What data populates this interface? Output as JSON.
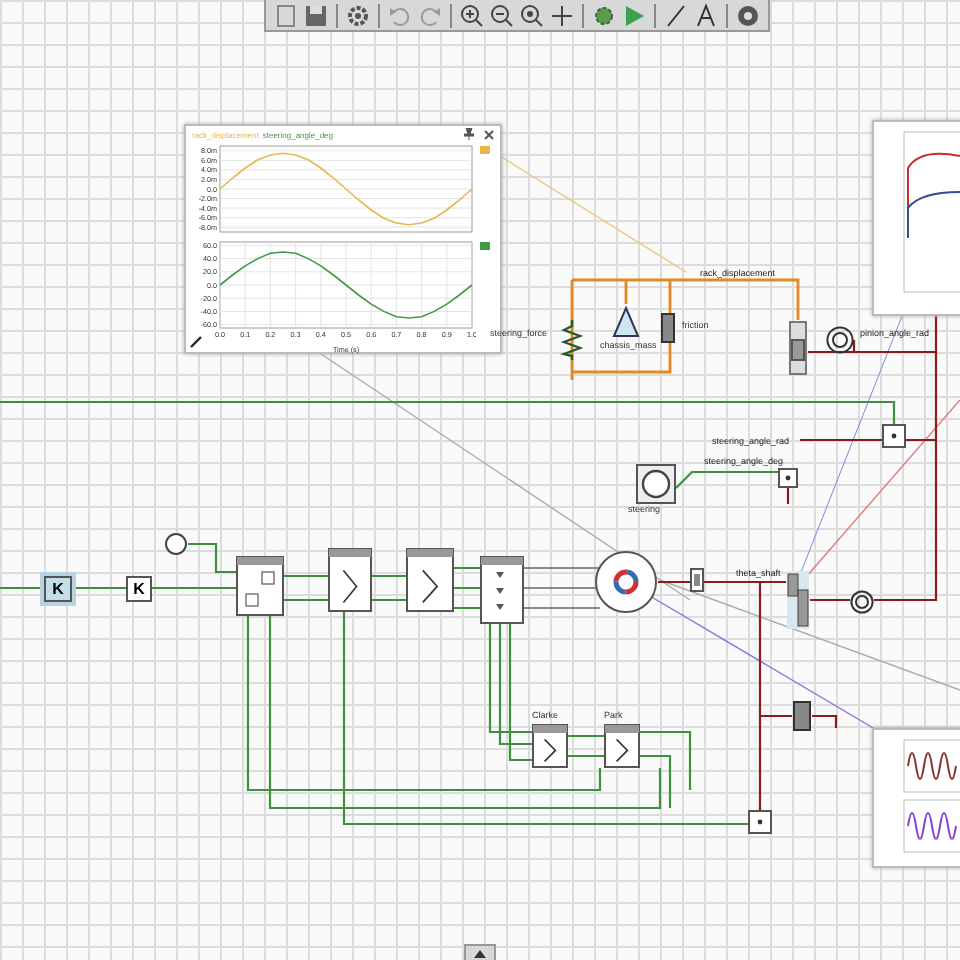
{
  "toolbar": {
    "buttons": [
      {
        "kind": "new"
      },
      {
        "kind": "save"
      },
      {
        "kind": "settings"
      },
      {
        "kind": "undo"
      },
      {
        "kind": "redo"
      },
      {
        "kind": "zoom-in"
      },
      {
        "kind": "zoom-out"
      },
      {
        "kind": "zoom-fit"
      },
      {
        "kind": "pan"
      },
      {
        "kind": "sim-settings"
      },
      {
        "kind": "run"
      },
      {
        "kind": "line"
      },
      {
        "kind": "text"
      },
      {
        "kind": "help"
      }
    ]
  },
  "plot_window": {
    "charts": [
      {
        "chart_data": {
          "type": "line",
          "grid": true,
          "x": [
            0,
            0.05,
            0.1,
            0.15,
            0.2,
            0.25,
            0.3,
            0.35,
            0.4,
            0.45,
            0.5,
            0.55,
            0.6,
            0.65,
            0.7,
            0.75,
            0.8,
            0.85,
            0.9,
            0.95,
            1
          ],
          "xlim": [
            0,
            1
          ],
          "ylim": [
            -9,
            9
          ],
          "yticks": [
            {
              "value": 8,
              "label": "8.0m"
            },
            {
              "value": 6,
              "label": "6.0m"
            },
            {
              "value": 4,
              "label": "4.0m"
            },
            {
              "value": 2,
              "label": "2.0m"
            },
            {
              "value": 0,
              "label": "0.0"
            },
            {
              "value": -2,
              "label": "-2.0m"
            },
            {
              "value": -4,
              "label": "-4.0m"
            },
            {
              "value": -6,
              "label": "-6.0m"
            },
            {
              "value": -8,
              "label": "-8.0m"
            }
          ],
          "series": [
            {
              "name": "rack_displacement",
              "color": "#e6b84c",
              "values": [
                0,
                2.3,
                4.4,
                6.1,
                7.1,
                7.5,
                7.1,
                6.1,
                4.4,
                2.3,
                0,
                -2.3,
                -4.4,
                -6.1,
                -7.1,
                -7.5,
                -7.1,
                -6.1,
                -4.4,
                -2.3,
                0
              ]
            }
          ]
        }
      },
      {
        "chart_data": {
          "type": "line",
          "grid": true,
          "xlabel": "Time (s)",
          "x": [
            0,
            0.05,
            0.1,
            0.15,
            0.2,
            0.25,
            0.3,
            0.35,
            0.4,
            0.45,
            0.5,
            0.55,
            0.6,
            0.65,
            0.7,
            0.75,
            0.8,
            0.85,
            0.9,
            0.95,
            1
          ],
          "xlim": [
            0,
            1
          ],
          "ylim": [
            -65,
            65
          ],
          "xticks": [
            {
              "value": 0,
              "label": "0.0"
            },
            {
              "value": 0.1,
              "label": "0.1"
            },
            {
              "value": 0.2,
              "label": "0.2"
            },
            {
              "value": 0.3,
              "label": "0.3"
            },
            {
              "value": 0.4,
              "label": "0.4"
            },
            {
              "value": 0.5,
              "label": "0.5"
            },
            {
              "value": 0.6,
              "label": "0.6"
            },
            {
              "value": 0.7,
              "label": "0.7"
            },
            {
              "value": 0.8,
              "label": "0.8"
            },
            {
              "value": 0.9,
              "label": "0.9"
            },
            {
              "value": 1,
              "label": "1.0"
            }
          ],
          "yticks": [
            {
              "value": 60,
              "label": "60.0"
            },
            {
              "value": 40,
              "label": "40.0"
            },
            {
              "value": 20,
              "label": "20.0"
            },
            {
              "value": 0,
              "label": "0.0"
            },
            {
              "value": -20,
              "label": "-20.0"
            },
            {
              "value": -40,
              "label": "-40.0"
            },
            {
              "value": -60,
              "label": "-60.0"
            }
          ],
          "series": [
            {
              "name": "steering_angle_deg",
              "color": "#3f9a45",
              "values": [
                0,
                15,
                29,
                40,
                48,
                50,
                48,
                40,
                29,
                15,
                0,
                -15,
                -29,
                -40,
                -48,
                -50,
                -48,
                -40,
                -29,
                -15,
                0
              ]
            }
          ]
        }
      }
    ]
  },
  "nodes": [
    {
      "kind": "gain",
      "symbol": "K",
      "selected": true
    },
    {
      "kind": "gain",
      "symbol": "K",
      "selected": false
    },
    {
      "kind": "source"
    },
    {
      "kind": "controller"
    },
    {
      "kind": "transform"
    },
    {
      "kind": "transform"
    },
    {
      "kind": "inverter"
    },
    {
      "kind": "motor"
    },
    {
      "kind": "transform",
      "label": "Clarke"
    },
    {
      "kind": "transform",
      "label": "Park"
    },
    {
      "kind": "spring",
      "label": "steering_force"
    },
    {
      "kind": "mass",
      "label": "chassis_mass"
    },
    {
      "kind": "damper",
      "label": "friction"
    },
    {
      "kind": "rack"
    },
    {
      "kind": "spiral"
    },
    {
      "kind": "wheel",
      "label": "steering"
    },
    {
      "kind": "sensor"
    },
    {
      "kind": "sensor"
    },
    {
      "kind": "sensor"
    },
    {
      "kind": "gearbox"
    },
    {
      "kind": "spiral"
    },
    {
      "kind": "damper"
    },
    {
      "kind": "coupling"
    }
  ],
  "wire_labels": [
    "rack_displacement",
    "pinion_angle_rad",
    "steering_angle_rad",
    "steering_angle_deg",
    "theta_shaft"
  ],
  "side_plots": [
    {
      "kind": "torque"
    },
    {
      "kind": "current"
    }
  ]
}
